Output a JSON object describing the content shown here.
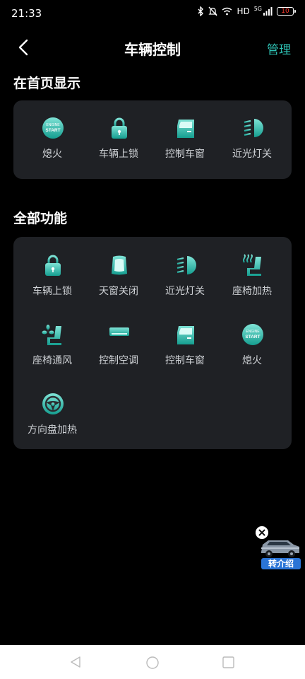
{
  "status_bar": {
    "time": "21:33",
    "network": "HD",
    "signal": "5G",
    "battery": "10"
  },
  "header": {
    "title": "车辆控制",
    "manage_label": "管理"
  },
  "home_section": {
    "title": "在首页显示",
    "items": [
      {
        "label": "熄火",
        "icon": "engine-start-icon"
      },
      {
        "label": "车辆上锁",
        "icon": "lock-icon"
      },
      {
        "label": "控制车窗",
        "icon": "car-window-icon"
      },
      {
        "label": "近光灯关",
        "icon": "low-beam-icon"
      }
    ]
  },
  "all_section": {
    "title": "全部功能",
    "items": [
      {
        "label": "车辆上锁",
        "icon": "lock-icon"
      },
      {
        "label": "天窗关闭",
        "icon": "sunroof-icon"
      },
      {
        "label": "近光灯关",
        "icon": "low-beam-icon"
      },
      {
        "label": "座椅加热",
        "icon": "seat-heat-icon"
      },
      {
        "label": "座椅通风",
        "icon": "seat-vent-icon"
      },
      {
        "label": "控制空调",
        "icon": "air-conditioner-icon"
      },
      {
        "label": "控制车窗",
        "icon": "car-window-icon"
      },
      {
        "label": "熄火",
        "icon": "engine-start-icon"
      },
      {
        "label": "方向盘加热",
        "icon": "steering-wheel-heat-icon"
      }
    ]
  },
  "float_ad": {
    "label": "转介绍"
  },
  "colors": {
    "accent": "#2ec4b6",
    "card": "#1f2125",
    "icon_light": "#7fe3d6",
    "icon_dark": "#159e90"
  }
}
